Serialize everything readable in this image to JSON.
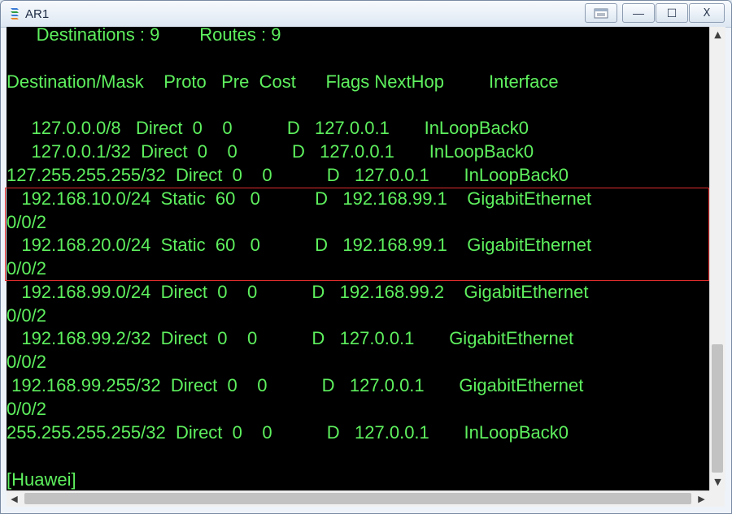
{
  "window": {
    "title": "AR1",
    "icon": "router-icon",
    "controls": {
      "restore": "restore-icon",
      "minimize": "—",
      "maximize": "☐",
      "close": "X"
    }
  },
  "terminal": {
    "lines": [
      "      Destinations : 9        Routes : 9",
      "",
      "Destination/Mask    Proto   Pre  Cost      Flags NextHop         Interface",
      "",
      "     127.0.0.0/8   Direct  0    0           D   127.0.0.1       InLoopBack0",
      "     127.0.0.1/32  Direct  0    0           D   127.0.0.1       InLoopBack0",
      "127.255.255.255/32  Direct  0    0           D   127.0.0.1       InLoopBack0",
      "   192.168.10.0/24  Static  60   0           D   192.168.99.1    GigabitEthernet",
      "0/0/2",
      "   192.168.20.0/24  Static  60   0           D   192.168.99.1    GigabitEthernet",
      "0/0/2",
      "   192.168.99.0/24  Direct  0    0           D   192.168.99.2    GigabitEthernet",
      "0/0/2",
      "   192.168.99.2/32  Direct  0    0           D   127.0.0.1       GigabitEthernet",
      "0/0/2",
      " 192.168.99.255/32  Direct  0    0           D   127.0.0.1       GigabitEthernet",
      "0/0/2",
      "255.255.255.255/32  Direct  0    0           D   127.0.0.1       InLoopBack0",
      "",
      "[Huawei]"
    ]
  },
  "scrollbars": {
    "up": "▲",
    "down": "▼",
    "left": "◀",
    "right": "▶"
  },
  "colors": {
    "terminal_bg": "#000000",
    "terminal_fg": "#5ef05e",
    "highlight_border": "#e02b2b"
  }
}
